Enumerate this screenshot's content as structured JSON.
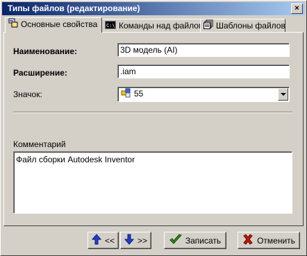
{
  "window": {
    "title": "Типы файлов (редактирование)",
    "close_glyph": "×"
  },
  "tabs": [
    {
      "label": "Основные свойства",
      "icon": "properties-icon",
      "active": true
    },
    {
      "label": "Команды над файлом",
      "icon": "command-prompt-icon",
      "active": false
    },
    {
      "label": "Шаблоны файлов",
      "icon": "templates-icon",
      "active": false
    }
  ],
  "form": {
    "name_label": "Наименование:",
    "name_value": "3D модель (AI)",
    "ext_label": "Расширение:",
    "ext_value": ".iam",
    "icon_label": "Значок:",
    "icon_value": "55",
    "comment_label": "Комментарий",
    "comment_value": "Файл сборки Autodesk Inventor"
  },
  "buttons": {
    "up_label": "<<",
    "down_label": ">>",
    "save_label": "Записать",
    "cancel_label": "Отменить"
  },
  "colors": {
    "title_start": "#0a246a",
    "title_end": "#a6caf0",
    "face": "#d4d0c8",
    "arrow_blue": "#1f3fd8",
    "check_green": "#2a8a1e",
    "cancel_red": "#c0180c"
  }
}
